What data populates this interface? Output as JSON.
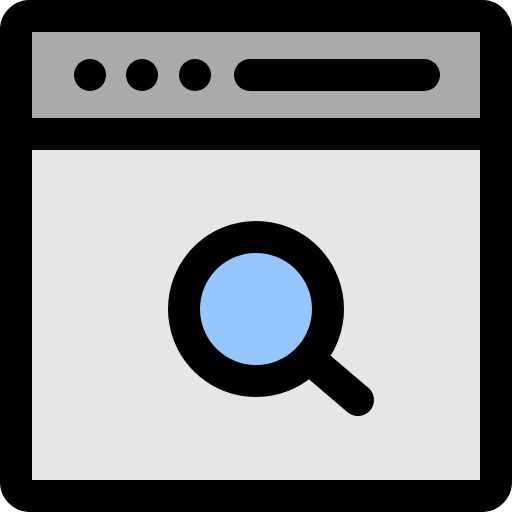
{
  "window": {
    "icon": "browser-window-icon",
    "titlebar": {
      "dots": [
        {
          "icon": "window-dot-icon"
        },
        {
          "icon": "window-dot-icon"
        },
        {
          "icon": "window-dot-icon"
        }
      ],
      "address_bar": {
        "icon": "address-bar-icon"
      }
    },
    "content": {
      "icon": "magnifier-icon"
    }
  },
  "colors": {
    "outline": "#000000",
    "titlebar_fill": "#aaaaaa",
    "content_fill": "#e6e6e6",
    "lens_fill": "#94c7ff"
  }
}
